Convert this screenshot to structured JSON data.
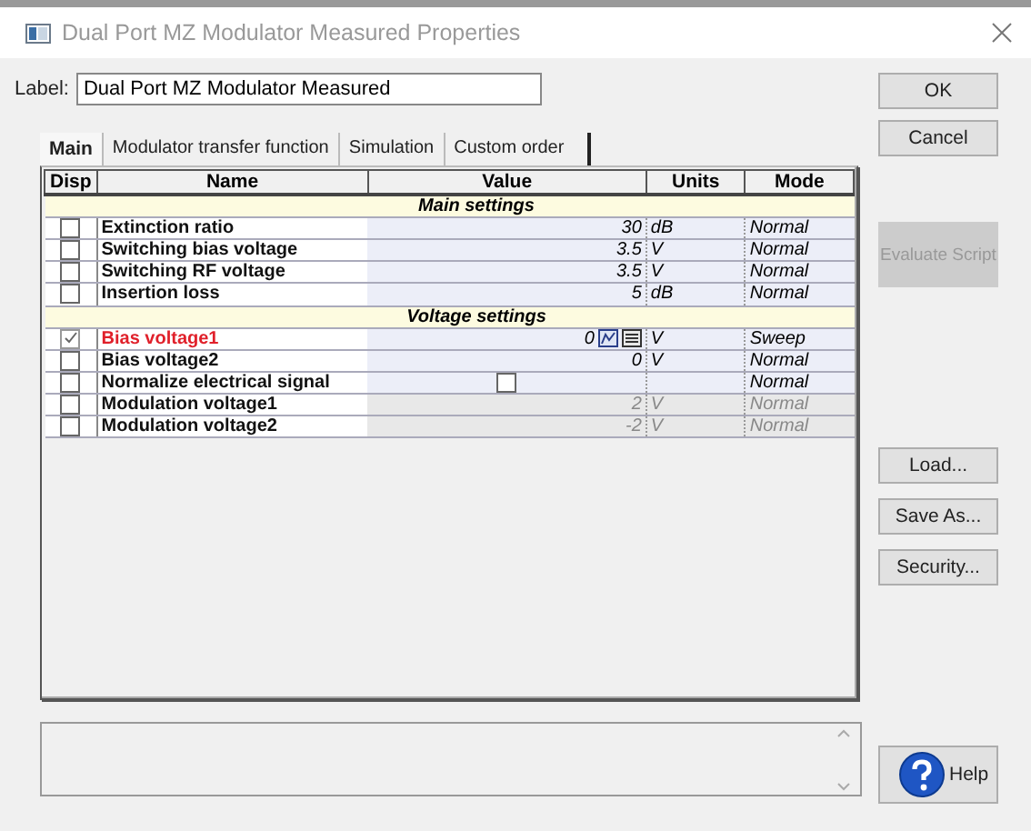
{
  "window": {
    "title": "Dual Port MZ Modulator Measured Properties"
  },
  "label": {
    "caption": "Label:",
    "value": "Dual Port MZ Modulator Measured"
  },
  "tabs": [
    {
      "label": "Main",
      "selected": true
    },
    {
      "label": "Modulator transfer function",
      "selected": false
    },
    {
      "label": "Simulation",
      "selected": false
    },
    {
      "label": "Custom order",
      "selected": false
    }
  ],
  "table": {
    "columns": [
      "Disp",
      "Name",
      "Value",
      "Units",
      "Mode"
    ],
    "rows": [
      {
        "kind": "section",
        "title": "Main settings"
      },
      {
        "kind": "number",
        "disp": false,
        "name": "Extinction ratio",
        "highlighted": false,
        "disabled": false,
        "value": "30",
        "units": "dB",
        "mode": "Normal"
      },
      {
        "kind": "number",
        "disp": false,
        "name": "Switching bias voltage",
        "highlighted": false,
        "disabled": false,
        "value": "3.5",
        "units": "V",
        "mode": "Normal"
      },
      {
        "kind": "number",
        "disp": false,
        "name": "Switching RF voltage",
        "highlighted": false,
        "disabled": false,
        "value": "3.5",
        "units": "V",
        "mode": "Normal"
      },
      {
        "kind": "number",
        "disp": false,
        "name": "Insertion loss",
        "highlighted": false,
        "disabled": false,
        "value": "5",
        "units": "dB",
        "mode": "Normal"
      },
      {
        "kind": "section",
        "title": "Voltage settings"
      },
      {
        "kind": "sweep",
        "disp": true,
        "name": "Bias voltage1",
        "highlighted": true,
        "disabled": false,
        "value": "0",
        "units": "V",
        "mode": "Sweep"
      },
      {
        "kind": "number",
        "disp": false,
        "name": "Bias voltage2",
        "highlighted": false,
        "disabled": false,
        "value": "0",
        "units": "V",
        "mode": "Normal"
      },
      {
        "kind": "toggle",
        "disp": false,
        "name": "Normalize electrical signal",
        "highlighted": false,
        "disabled": false,
        "checked": false,
        "mode": "Normal"
      },
      {
        "kind": "number",
        "disp": false,
        "name": "Modulation voltage1",
        "highlighted": false,
        "disabled": true,
        "value": "2",
        "units": "V",
        "mode": "Normal"
      },
      {
        "kind": "number",
        "disp": false,
        "name": "Modulation voltage2",
        "highlighted": false,
        "disabled": true,
        "value": "-2",
        "units": "V",
        "mode": "Normal"
      }
    ]
  },
  "top_buttons": [
    {
      "label": "OK",
      "disabled": false
    },
    {
      "label": "Cancel",
      "disabled": false
    }
  ],
  "script_buttons": [
    {
      "label": "Evaluate Script",
      "disabled": true
    }
  ],
  "file_buttons": [
    {
      "label": "Load...",
      "disabled": false
    },
    {
      "label": "Save As...",
      "disabled": false
    },
    {
      "label": "Security...",
      "disabled": false
    }
  ],
  "help": {
    "label": "Help"
  }
}
